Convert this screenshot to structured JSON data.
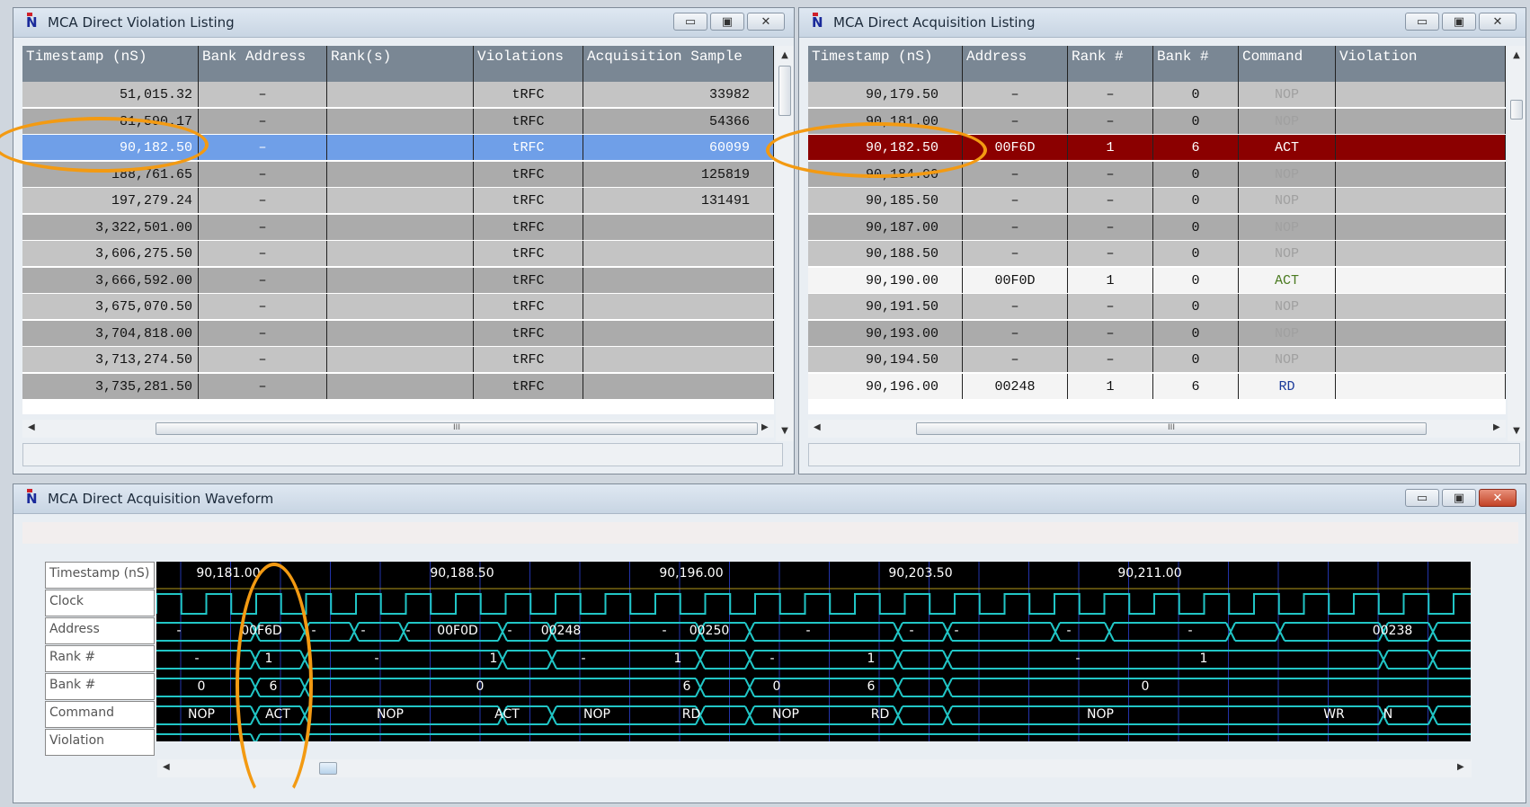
{
  "colors": {
    "selected_row": "#6f9fe8",
    "act_row": "#8b0000",
    "annotation": "#f39a12",
    "trace": "#21c6c6"
  },
  "violation": {
    "title": "MCA Direct Violation Listing",
    "columns": [
      "Timestamp (nS)",
      "Bank Address",
      "Rank(s)",
      "Violations",
      "Acquisition Sample"
    ],
    "rows": [
      [
        "51,015.32",
        "–",
        "",
        "tRFC",
        "33982"
      ],
      [
        "81,590.17",
        "–",
        "",
        "tRFC",
        "54366"
      ],
      [
        "90,182.50",
        "–",
        "",
        "tRFC",
        "60099"
      ],
      [
        "188,761.65",
        "–",
        "",
        "tRFC",
        "125819"
      ],
      [
        "197,279.24",
        "–",
        "",
        "tRFC",
        "131491"
      ],
      [
        "3,322,501.00",
        "–",
        "",
        "tRFC",
        ""
      ],
      [
        "3,606,275.50",
        "–",
        "",
        "tRFC",
        ""
      ],
      [
        "3,666,592.00",
        "–",
        "",
        "tRFC",
        ""
      ],
      [
        "3,675,070.50",
        "–",
        "",
        "tRFC",
        ""
      ],
      [
        "3,704,818.00",
        "–",
        "",
        "tRFC",
        ""
      ],
      [
        "3,713,274.50",
        "–",
        "",
        "tRFC",
        ""
      ],
      [
        "3,735,281.50",
        "–",
        "",
        "tRFC",
        ""
      ]
    ],
    "selected_index": 2,
    "hscroll_mark": "III"
  },
  "acquisition": {
    "title": "MCA Direct Acquisition Listing",
    "columns": [
      "Timestamp (nS)",
      "Address",
      "Rank #",
      "Bank #",
      "Command",
      "Violation"
    ],
    "rows": [
      [
        "90,179.50",
        "–",
        "–",
        "0",
        "NOP",
        ""
      ],
      [
        "90,181.00",
        "–",
        "–",
        "0",
        "NOP",
        ""
      ],
      [
        "90,182.50",
        "00F6D",
        "1",
        "6",
        "ACT",
        ""
      ],
      [
        "90,184.00",
        "–",
        "–",
        "0",
        "NOP",
        ""
      ],
      [
        "90,185.50",
        "–",
        "–",
        "0",
        "NOP",
        ""
      ],
      [
        "90,187.00",
        "–",
        "–",
        "0",
        "NOP",
        ""
      ],
      [
        "90,188.50",
        "–",
        "–",
        "0",
        "NOP",
        ""
      ],
      [
        "90,190.00",
        "00F0D",
        "1",
        "0",
        "ACT",
        ""
      ],
      [
        "90,191.50",
        "–",
        "–",
        "0",
        "NOP",
        ""
      ],
      [
        "90,193.00",
        "–",
        "–",
        "0",
        "NOP",
        ""
      ],
      [
        "90,194.50",
        "–",
        "–",
        "0",
        "NOP",
        ""
      ],
      [
        "90,196.00",
        "00248",
        "1",
        "6",
        "RD",
        ""
      ]
    ],
    "highlight_index": 2,
    "hscroll_mark": "III"
  },
  "waveform": {
    "title": "MCA Direct Acquisition Waveform",
    "labels": [
      "Timestamp (nS)",
      "Clock",
      "Address",
      "Rank #",
      "Bank #",
      "Command",
      "Violation"
    ],
    "timestamps": [
      "90,181.00",
      "90,188.50",
      "90,196.00",
      "90,203.50",
      "90,211.00"
    ],
    "address": [
      "-",
      "00F6D",
      "-",
      "-",
      "-",
      "00F0D",
      "-",
      "00248",
      "-",
      "00250",
      "-",
      "-",
      "-",
      "-",
      "-",
      "00238"
    ],
    "rank": [
      "-",
      "1",
      "-",
      "1",
      "-",
      "1",
      "-",
      "1",
      "-",
      "1"
    ],
    "bank": [
      "0",
      "6",
      "0",
      "6",
      "0",
      "6",
      "0"
    ],
    "command": [
      "NOP",
      "ACT",
      "NOP",
      "ACT",
      "NOP",
      "RD",
      "NOP",
      "RD",
      "NOP",
      "WR",
      "N"
    ]
  }
}
